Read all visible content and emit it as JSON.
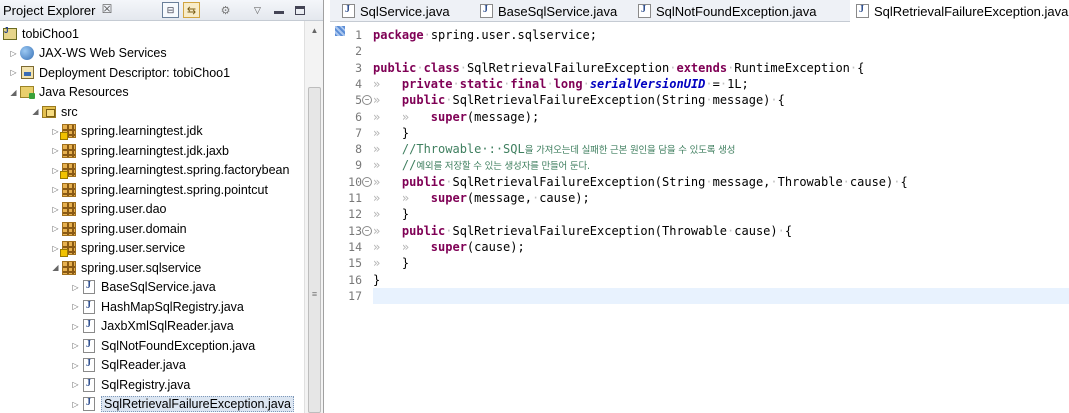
{
  "explorer": {
    "title": "Project Explorer",
    "close_glyph": "☒",
    "tree": [
      {
        "label": "tobiChoo1",
        "icon": "project-icon",
        "indent": 0,
        "twisty": "expanded-root"
      },
      {
        "label": "JAX-WS Web Services",
        "icon": "web-services-icon",
        "indent": 1,
        "twisty": "collapsed"
      },
      {
        "label": "Deployment Descriptor: tobiChoo1",
        "icon": "deployment-descriptor-icon",
        "indent": 1,
        "twisty": "collapsed"
      },
      {
        "label": "Java Resources",
        "icon": "java-resources-icon",
        "indent": 1,
        "twisty": "expanded"
      },
      {
        "label": "src",
        "icon": "source-folder-icon",
        "indent": 2,
        "twisty": "expanded"
      },
      {
        "label": "spring.learningtest.jdk",
        "icon": "package-warning-icon",
        "indent": 3,
        "twisty": "collapsed"
      },
      {
        "label": "spring.learningtest.jdk.jaxb",
        "icon": "package-icon",
        "indent": 3,
        "twisty": "collapsed"
      },
      {
        "label": "spring.learningtest.spring.factorybean",
        "icon": "package-warning-icon",
        "indent": 3,
        "twisty": "collapsed"
      },
      {
        "label": "spring.learningtest.spring.pointcut",
        "icon": "package-icon",
        "indent": 3,
        "twisty": "collapsed"
      },
      {
        "label": "spring.user.dao",
        "icon": "package-icon",
        "indent": 3,
        "twisty": "collapsed"
      },
      {
        "label": "spring.user.domain",
        "icon": "package-icon",
        "indent": 3,
        "twisty": "collapsed"
      },
      {
        "label": "spring.user.service",
        "icon": "package-warning-icon",
        "indent": 3,
        "twisty": "collapsed"
      },
      {
        "label": "spring.user.sqlservice",
        "icon": "package-icon",
        "indent": 3,
        "twisty": "expanded"
      },
      {
        "label": "BaseSqlService.java",
        "icon": "java-file-icon",
        "indent": 4,
        "twisty": "collapsed"
      },
      {
        "label": "HashMapSqlRegistry.java",
        "icon": "java-file-icon",
        "indent": 4,
        "twisty": "collapsed"
      },
      {
        "label": "JaxbXmlSqlReader.java",
        "icon": "java-file-icon",
        "indent": 4,
        "twisty": "collapsed"
      },
      {
        "label": "SqlNotFoundException.java",
        "icon": "java-file-icon",
        "indent": 4,
        "twisty": "collapsed"
      },
      {
        "label": "SqlReader.java",
        "icon": "java-file-icon",
        "indent": 4,
        "twisty": "collapsed"
      },
      {
        "label": "SqlRegistry.java",
        "icon": "java-file-icon",
        "indent": 4,
        "twisty": "collapsed"
      },
      {
        "label": "SqlRetrievalFailureException.java",
        "icon": "java-file-icon",
        "indent": 4,
        "twisty": "collapsed",
        "selected": true
      }
    ]
  },
  "editor": {
    "tabs": [
      {
        "label": "SqlService.java",
        "active": false
      },
      {
        "label": "BaseSqlService.java",
        "active": false
      },
      {
        "label": "SqlNotFoundException.java",
        "active": false
      },
      {
        "label": "SqlRetrievalFailureException.java",
        "active": true
      }
    ],
    "current_line": 17,
    "lines": [
      {
        "n": "1",
        "fold": "",
        "html": "<span class=\"kw\">package</span><span class=\"ws-dot\">·</span>spring.user.sqlservice;"
      },
      {
        "n": "2",
        "fold": "",
        "html": ""
      },
      {
        "n": "3",
        "fold": "",
        "html": "<span class=\"kw\">public</span><span class=\"ws-dot\">·</span><span class=\"kw\">class</span><span class=\"ws-dot\">·</span>SqlRetrievalFailureException<span class=\"ws-dot\">·</span><span class=\"kw\">extends</span><span class=\"ws-dot\">·</span>RuntimeException<span class=\"ws-dot\">·</span>{"
      },
      {
        "n": "4",
        "fold": "",
        "html": "<span class=\"ws\">»   </span><span class=\"kw\">private</span><span class=\"ws-dot\">·</span><span class=\"kw\">static</span><span class=\"ws-dot\">·</span><span class=\"kw\">final</span><span class=\"ws-dot\">·</span><span class=\"kw\">long</span><span class=\"ws-dot\">·</span><span class=\"ital\">serialVersionUID</span><span class=\"ws-dot\">·</span>=<span class=\"ws-dot\">·</span>1L;"
      },
      {
        "n": "5",
        "fold": "⊖",
        "html": "<span class=\"ws\">»   </span><span class=\"kw\">public</span><span class=\"ws-dot\">·</span>SqlRetrievalFailureException(String<span class=\"ws-dot\">·</span>message)<span class=\"ws-dot\">·</span>{"
      },
      {
        "n": "6",
        "fold": "",
        "html": "<span class=\"ws\">»   »   </span><span class=\"kw\">super</span>(message);"
      },
      {
        "n": "7",
        "fold": "",
        "html": "<span class=\"ws\">»   </span>}"
      },
      {
        "n": "8",
        "fold": "",
        "html": "<span class=\"ws\">»   </span><span class=\"cm\">//Throwable·:·SQL</span><span class=\"ko\">을 가져오는데 실패한 근본 원인을 담을 수 있도록 생성</span>"
      },
      {
        "n": "9",
        "fold": "",
        "html": "<span class=\"ws\">»   </span><span class=\"cm\">//</span><span class=\"ko\">예외를 저장할 수 있는 생성자를 만들어 둔다.</span>"
      },
      {
        "n": "10",
        "fold": "⊖",
        "html": "<span class=\"ws\">»   </span><span class=\"kw\">public</span><span class=\"ws-dot\">·</span>SqlRetrievalFailureException(String<span class=\"ws-dot\">·</span>message,<span class=\"ws-dot\">·</span>Throwable<span class=\"ws-dot\">·</span>cause)<span class=\"ws-dot\">·</span>{"
      },
      {
        "n": "11",
        "fold": "",
        "html": "<span class=\"ws\">»   »   </span><span class=\"kw\">super</span>(message,<span class=\"ws-dot\">·</span>cause);"
      },
      {
        "n": "12",
        "fold": "",
        "html": "<span class=\"ws\">»   </span>}"
      },
      {
        "n": "13",
        "fold": "⊖",
        "html": "<span class=\"ws\">»   </span><span class=\"kw\">public</span><span class=\"ws-dot\">·</span>SqlRetrievalFailureException(Throwable<span class=\"ws-dot\">·</span>cause)<span class=\"ws-dot\">·</span>{"
      },
      {
        "n": "14",
        "fold": "",
        "html": "<span class=\"ws\">»   »   </span><span class=\"kw\">super</span>(cause);"
      },
      {
        "n": "15",
        "fold": "",
        "html": "<span class=\"ws\">»   </span>}"
      },
      {
        "n": "16",
        "fold": "",
        "html": "}"
      },
      {
        "n": "17",
        "fold": "",
        "html": ""
      }
    ]
  }
}
